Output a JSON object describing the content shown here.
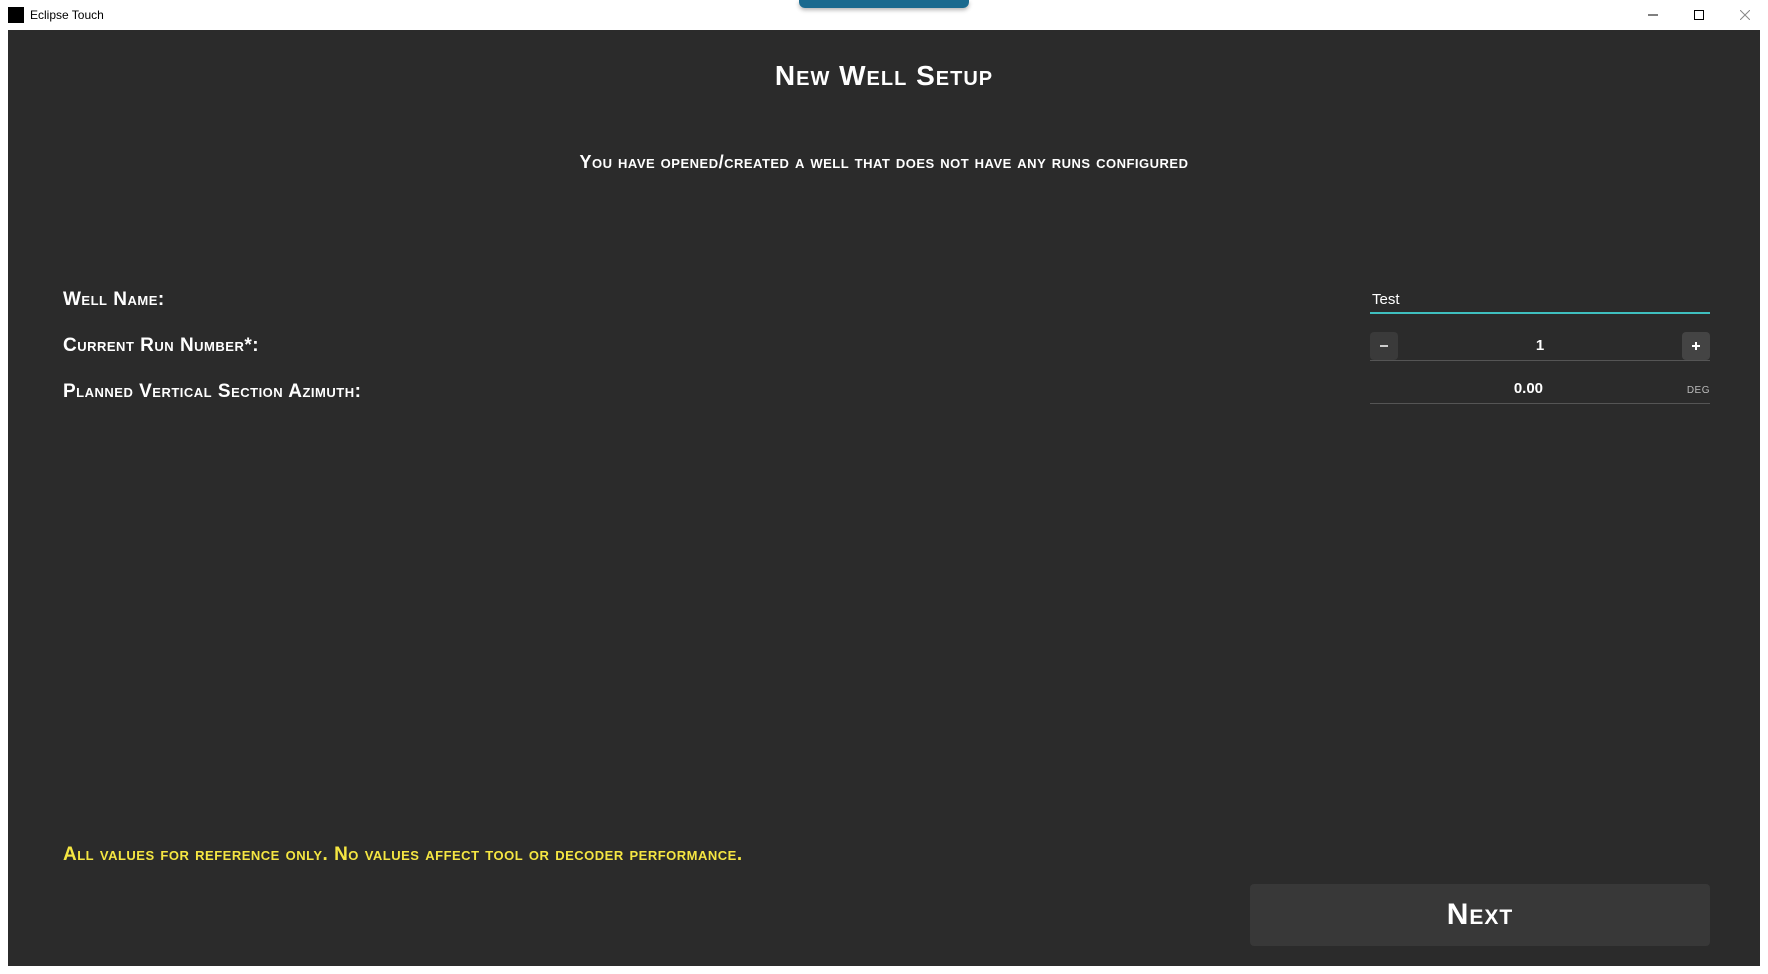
{
  "window": {
    "title": "Eclipse Touch"
  },
  "page": {
    "title": "New Well Setup",
    "subtitle": "You have opened/created a well that does not have any runs configured"
  },
  "form": {
    "well_name_label": "Well Name:",
    "well_name_value": "Test",
    "run_number_label": "Current Run Number*:",
    "run_number_value": "1",
    "azimuth_label": "Planned Vertical Section Azimuth:",
    "azimuth_value": "0.00",
    "azimuth_unit": "DEG"
  },
  "notice": "All values for reference only.  No values affect tool or decoder performance.",
  "buttons": {
    "next": "Next"
  }
}
